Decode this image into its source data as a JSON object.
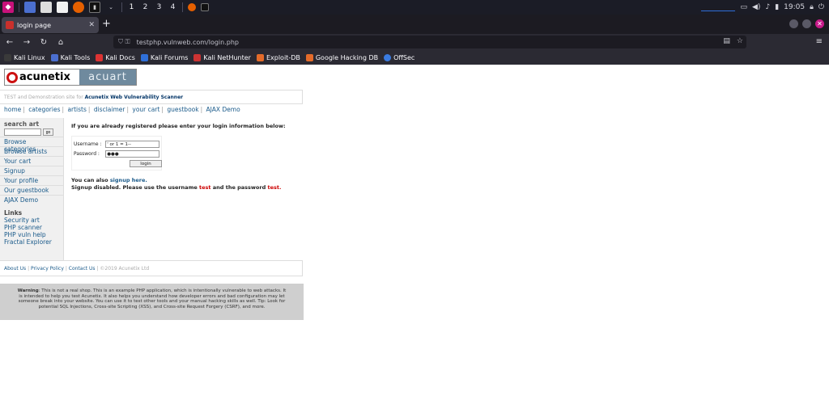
{
  "taskbar": {
    "workspaces": [
      "1",
      "2",
      "3",
      "4"
    ],
    "clock": "19:05"
  },
  "browser": {
    "tab_title": "login page",
    "new_tab": "+",
    "url": "testphp.vulnweb.com/login.php",
    "bookmarks": [
      "Kali Linux",
      "Kali Tools",
      "Kali Docs",
      "Kali Forums",
      "Kali NetHunter",
      "Exploit-DB",
      "Google Hacking DB",
      "OffSec"
    ],
    "bookmark_colors": [
      "#3a3a3a",
      "#4b6fd0",
      "#d33",
      "#2f6fd8",
      "#c33",
      "#e46b2a",
      "#e46b2a",
      "#3a7be0"
    ]
  },
  "site": {
    "logo_left": "acunetix",
    "logo_right": "acuart",
    "tagline_pre": "TEST and Demonstration site for",
    "tagline_link": "Acunetix Web Vulnerability Scanner",
    "nav": [
      "home",
      "categories",
      "artists",
      "disclaimer",
      "your cart",
      "guestbook",
      "AJAX Demo"
    ],
    "sidebar": {
      "search_head": "search art",
      "go": "go",
      "items": [
        "Browse categories",
        "Browse artists",
        "Your cart",
        "Signup",
        "Your profile",
        "Our guestbook",
        "AJAX Demo"
      ],
      "links_head": "Links",
      "links": [
        "Security art",
        "PHP scanner",
        "PHP vuln help",
        "Fractal Explorer"
      ]
    },
    "login": {
      "intro": "If you are already registered please enter your login information below:",
      "username_label": "Username :",
      "username_value": "' or 1 = 1--",
      "password_label": "Password :",
      "password_value": "●●●",
      "button": "login",
      "also_pre": "You can also",
      "also_link": "signup here.",
      "disabled_pre": "Signup disabled. Please use the username",
      "user": "test",
      "disabled_mid": "and the password",
      "pass": "test."
    },
    "footer": {
      "about": "About Us",
      "privacy": "Privacy Policy",
      "contact": "Contact Us",
      "copyright": "©2019 Acunetix Ltd"
    },
    "warning": {
      "bold": "Warning",
      "text": ": This is not a real shop. This is an example PHP application, which is intentionally vulnerable to web attacks. It is intended to help you test Acunetix. It also helps you understand how developer errors and bad configuration may let someone break into your website. You can use it to test other tools and your manual hacking skills as well. Tip: Look for potential SQL Injections, Cross-site Scripting (XSS), and Cross-site Request Forgery (CSRF), and more."
    }
  }
}
